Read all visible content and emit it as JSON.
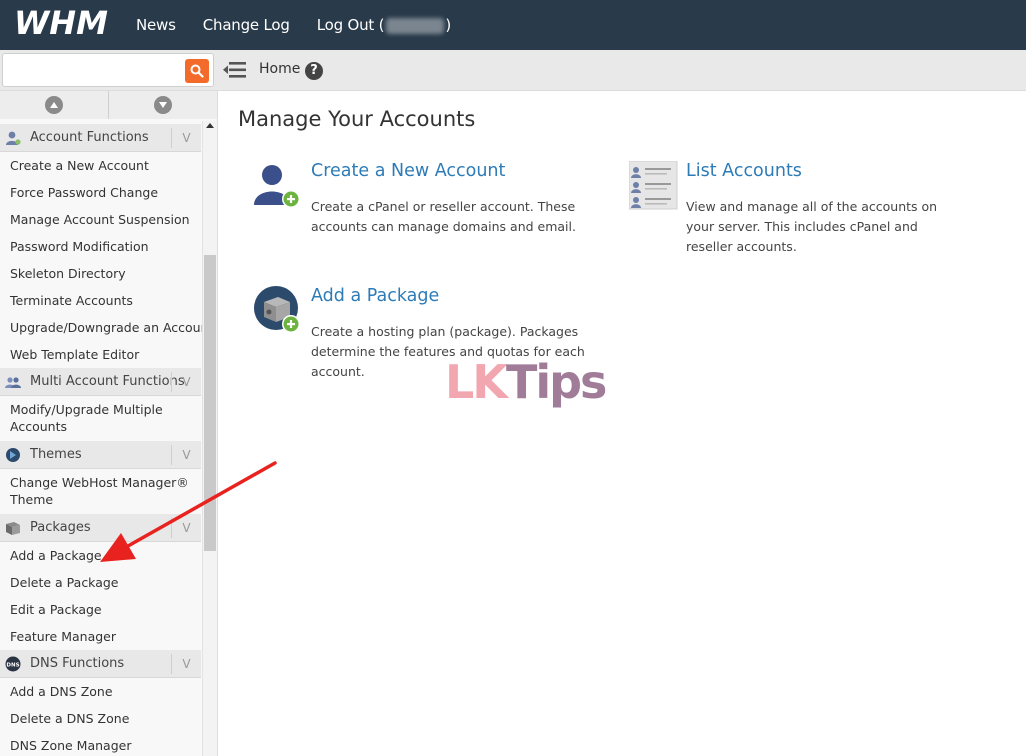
{
  "topbar": {
    "logo": "WHM",
    "nav": [
      {
        "label": "News"
      },
      {
        "label": "Change Log"
      },
      {
        "label": "Log Out ("
      }
    ],
    "logout_suffix": ")"
  },
  "subbar": {
    "search_placeholder": "",
    "breadcrumb": "Home",
    "help": "?"
  },
  "sidebar": {
    "categories": [
      {
        "label": "Account Functions",
        "icon": "user-icon",
        "items": [
          "Create a New Account",
          "Force Password Change",
          "Manage Account Suspension",
          "Password Modification",
          "Skeleton Directory",
          "Terminate Accounts",
          "Upgrade/Downgrade an Account",
          "Web Template Editor"
        ]
      },
      {
        "label": "Multi Account Functions",
        "icon": "users-icon",
        "items": [
          "Modify/Upgrade Multiple Accounts"
        ]
      },
      {
        "label": "Themes",
        "icon": "theme-icon",
        "items": [
          "Change WebHost Manager® Theme"
        ]
      },
      {
        "label": "Packages",
        "icon": "package-icon",
        "items": [
          "Add a Package",
          "Delete a Package",
          "Edit a Package",
          "Feature Manager"
        ]
      },
      {
        "label": "DNS Functions",
        "icon": "dns-icon",
        "items": [
          "Add a DNS Zone",
          "Delete a DNS Zone",
          "DNS Zone Manager"
        ]
      }
    ],
    "toggle": "V"
  },
  "main": {
    "title": "Manage Your Accounts",
    "cards": [
      {
        "title": "Create a New Account",
        "desc": "Create a cPanel or reseller account. These accounts can manage domains and email."
      },
      {
        "title": "List Accounts",
        "desc": "View and manage all of the accounts on your server. This includes cPanel and reseller accounts."
      },
      {
        "title": "Add a Package",
        "desc": "Create a hosting plan (package). Packages determine the features and quotas for each account."
      }
    ]
  },
  "watermark": {
    "part1": "LK",
    "part2": "Tips"
  },
  "colors": {
    "topbar": "#293a4a",
    "link": "#2d7bb7",
    "search_button": "#f26b2a",
    "annotation_arrow": "#e8231f"
  }
}
